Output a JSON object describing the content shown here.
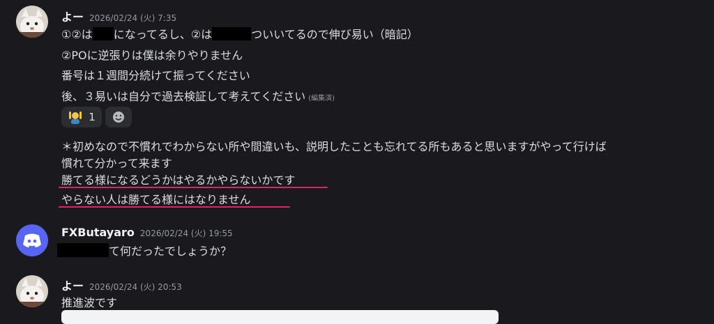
{
  "messages": [
    {
      "author": "よー",
      "timestamp": "2026/02/24 (火) 7:35",
      "lines": {
        "l1a": "①②は",
        "l1b": "になってるし、②は",
        "l1c": "ついいてるので伸び易い（暗記）",
        "l2": "②POに逆張りは僕は余りやりません",
        "l3": "番号は１週間分続けて振ってください",
        "l4": "後、３易いは自分で過去検証して考えてください",
        "edited": "(編集済)",
        "l5": "＊初めなので不慣れでわからない所や間違いも、説明したことも忘れてる所もあると思いますがやって行けば",
        "l6": "慣れて分かって来ます",
        "l7": "勝てる様になるどうかはやるかやらないかです",
        "l8": "やらない人は勝てる様にはなりません"
      },
      "reactions": [
        {
          "emoji": "person-raising-hand",
          "count": "1"
        },
        {
          "emoji": "add-reaction",
          "count": ""
        }
      ]
    },
    {
      "author": "FXButayaro",
      "timestamp": "2026/02/24 (火) 19:55",
      "text": "て何だったでしょうか？"
    },
    {
      "author": "よー",
      "timestamp": "2026/02/24 (火) 20:53",
      "text": "推進波です"
    }
  ],
  "colors": {
    "background": "#1a1a1e",
    "text": "#dbdee1",
    "timestamp": "#949ba4",
    "discord_blurple": "#5865f2",
    "underline_annotation": "#e0245e"
  }
}
